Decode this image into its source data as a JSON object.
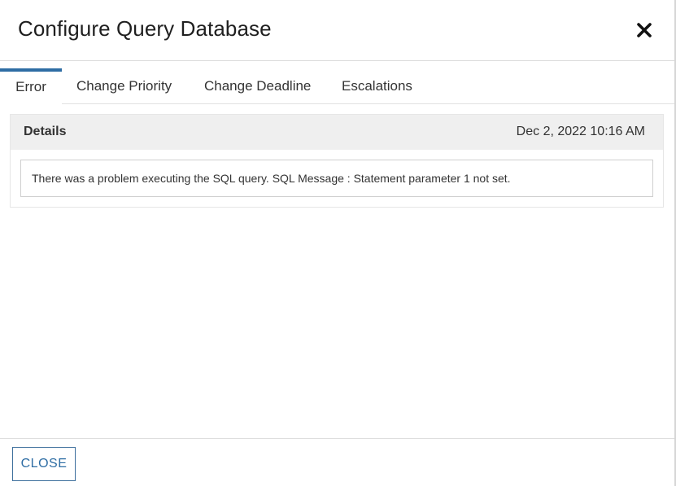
{
  "dialog": {
    "title": "Configure Query Database",
    "close_icon": "close-icon"
  },
  "tabs": [
    {
      "label": "Error",
      "active": true
    },
    {
      "label": "Change Priority",
      "active": false
    },
    {
      "label": "Change Deadline",
      "active": false
    },
    {
      "label": "Escalations",
      "active": false
    }
  ],
  "details": {
    "title": "Details",
    "timestamp": "Dec 2, 2022 10:16 AM",
    "message": "There was a problem executing the SQL query. SQL Message : Statement parameter 1 not set."
  },
  "footer": {
    "close_label": "CLOSE"
  },
  "colors": {
    "accent": "#2e6da4",
    "panel_header": "#efefef"
  }
}
